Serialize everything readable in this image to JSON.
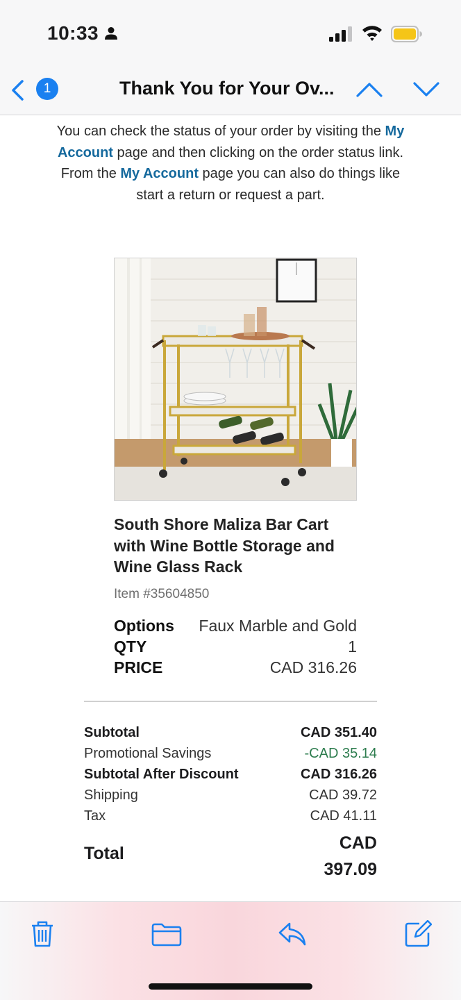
{
  "status_bar": {
    "time": "10:33",
    "icons": [
      "person-icon",
      "cellular-signal-icon",
      "wifi-icon",
      "battery-icon"
    ]
  },
  "nav": {
    "unread_count": "1",
    "title": "Thank You for Your Ov...",
    "icons": [
      "back-chevron-icon",
      "up-chevron-icon",
      "down-chevron-icon"
    ],
    "accent_color": "#1a80f0"
  },
  "intro": {
    "part1": "You can check the status of your order by visiting the ",
    "link1": "My Account",
    "part2": " page and then clicking on the order status link. From the ",
    "link2": "My Account",
    "part3": " page you can also do things like start a return or request a part.",
    "link_color": "#15699d"
  },
  "product": {
    "name": "South Shore Maliza Bar Cart with Wine Bottle Storage and Wine Glass Rack",
    "item_number": "Item #35604850",
    "options_label": "Options",
    "options_value": "Faux Marble and Gold",
    "qty_label": "QTY",
    "qty_value": "1",
    "price_label": "PRICE",
    "price_value": "CAD 316.26"
  },
  "summary": {
    "subtotal_label": "Subtotal",
    "subtotal_value": "CAD 351.40",
    "savings_label": "Promotional Savings",
    "savings_value": "-CAD 35.14",
    "after_discount_label": "Subtotal After Discount",
    "after_discount_value": "CAD 316.26",
    "shipping_label": "Shipping",
    "shipping_value": "CAD 39.72",
    "tax_label": "Tax",
    "tax_value": "CAD 41.11",
    "total_label": "Total",
    "total_currency": "CAD",
    "total_amount": "397.09",
    "savings_color": "#2e7d4f"
  },
  "toolbar": {
    "icons": [
      "trash-icon",
      "folder-icon",
      "reply-icon",
      "compose-icon"
    ]
  }
}
